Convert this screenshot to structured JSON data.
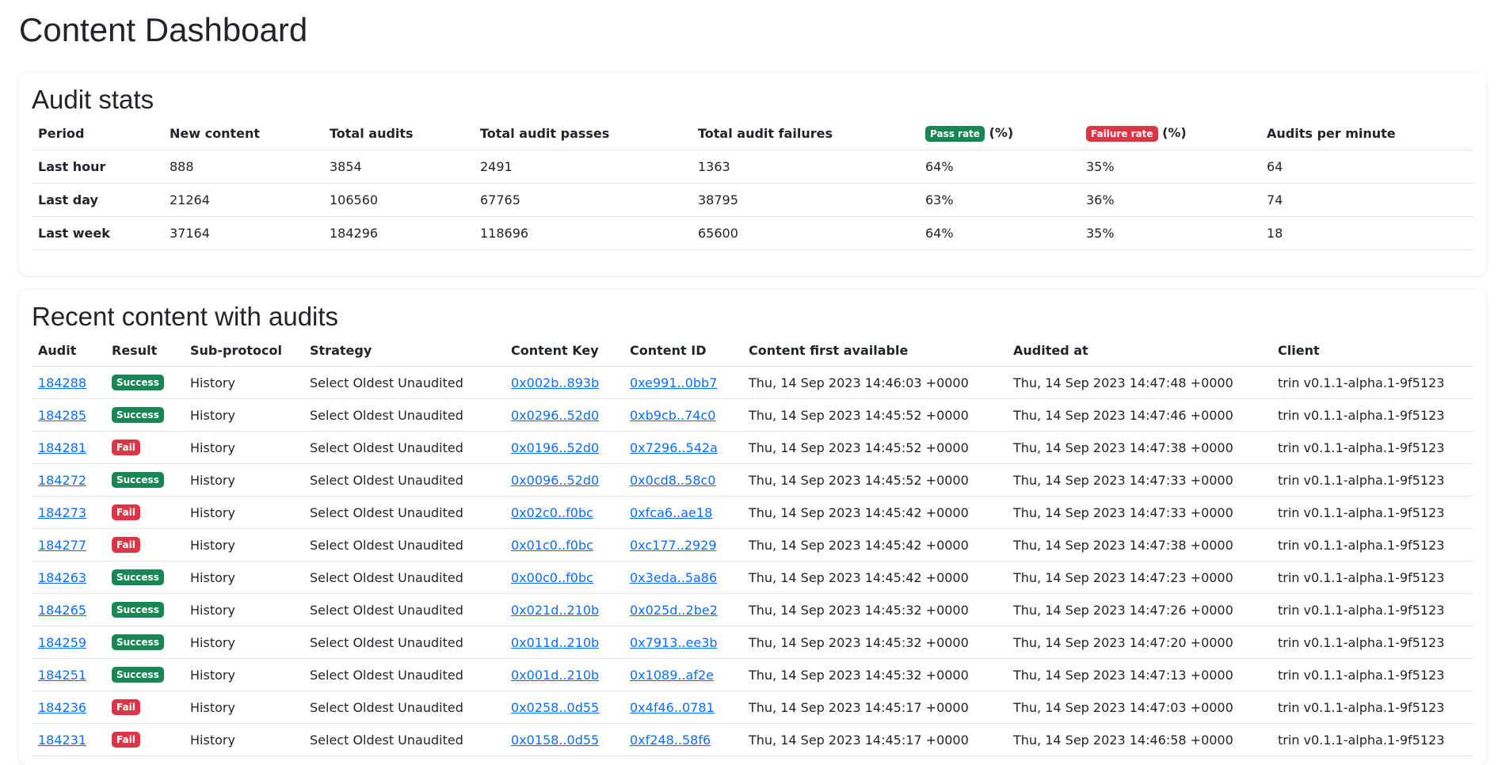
{
  "page": {
    "title": "Content Dashboard"
  },
  "colors": {
    "success": "#198754",
    "danger": "#dc3545",
    "link": "#0d6efd"
  },
  "stats": {
    "title": "Audit stats",
    "headers": {
      "period": "Period",
      "new_content": "New content",
      "total_audits": "Total audits",
      "total_passes": "Total audit passes",
      "total_failures": "Total audit failures",
      "pass_rate_badge": "Pass rate",
      "pass_rate_unit": "(%)",
      "failure_rate_badge": "Failure rate",
      "failure_rate_unit": "(%)",
      "audits_per_minute": "Audits per minute"
    },
    "rows": [
      {
        "period": "Last hour",
        "new_content": "888",
        "total_audits": "3854",
        "passes": "2491",
        "failures": "1363",
        "pass_rate": "64%",
        "failure_rate": "35%",
        "apm": "64"
      },
      {
        "period": "Last day",
        "new_content": "21264",
        "total_audits": "106560",
        "passes": "67765",
        "failures": "38795",
        "pass_rate": "63%",
        "failure_rate": "36%",
        "apm": "74"
      },
      {
        "period": "Last week",
        "new_content": "37164",
        "total_audits": "184296",
        "passes": "118696",
        "failures": "65600",
        "pass_rate": "64%",
        "failure_rate": "35%",
        "apm": "18"
      }
    ]
  },
  "recent": {
    "title": "Recent content with audits",
    "headers": {
      "audit": "Audit",
      "result": "Result",
      "subprotocol": "Sub-protocol",
      "strategy": "Strategy",
      "content_key": "Content Key",
      "content_id": "Content ID",
      "first_available": "Content first available",
      "audited_at": "Audited at",
      "client": "Client"
    },
    "rows": [
      {
        "audit": "184288",
        "result": "Success",
        "subprotocol": "History",
        "strategy": "Select Oldest Unaudited",
        "content_key": "0x002b..893b",
        "content_id": "0xe991..0bb7",
        "first_available": "Thu, 14 Sep 2023 14:46:03 +0000",
        "audited_at": "Thu, 14 Sep 2023 14:47:48 +0000",
        "client": "trin v0.1.1-alpha.1-9f5123"
      },
      {
        "audit": "184285",
        "result": "Success",
        "subprotocol": "History",
        "strategy": "Select Oldest Unaudited",
        "content_key": "0x0296..52d0",
        "content_id": "0xb9cb..74c0",
        "first_available": "Thu, 14 Sep 2023 14:45:52 +0000",
        "audited_at": "Thu, 14 Sep 2023 14:47:46 +0000",
        "client": "trin v0.1.1-alpha.1-9f5123"
      },
      {
        "audit": "184281",
        "result": "Fail",
        "subprotocol": "History",
        "strategy": "Select Oldest Unaudited",
        "content_key": "0x0196..52d0",
        "content_id": "0x7296..542a",
        "first_available": "Thu, 14 Sep 2023 14:45:52 +0000",
        "audited_at": "Thu, 14 Sep 2023 14:47:38 +0000",
        "client": "trin v0.1.1-alpha.1-9f5123"
      },
      {
        "audit": "184272",
        "result": "Success",
        "subprotocol": "History",
        "strategy": "Select Oldest Unaudited",
        "content_key": "0x0096..52d0",
        "content_id": "0x0cd8..58c0",
        "first_available": "Thu, 14 Sep 2023 14:45:52 +0000",
        "audited_at": "Thu, 14 Sep 2023 14:47:33 +0000",
        "client": "trin v0.1.1-alpha.1-9f5123"
      },
      {
        "audit": "184273",
        "result": "Fail",
        "subprotocol": "History",
        "strategy": "Select Oldest Unaudited",
        "content_key": "0x02c0..f0bc",
        "content_id": "0xfca6..ae18",
        "first_available": "Thu, 14 Sep 2023 14:45:42 +0000",
        "audited_at": "Thu, 14 Sep 2023 14:47:33 +0000",
        "client": "trin v0.1.1-alpha.1-9f5123"
      },
      {
        "audit": "184277",
        "result": "Fail",
        "subprotocol": "History",
        "strategy": "Select Oldest Unaudited",
        "content_key": "0x01c0..f0bc",
        "content_id": "0xc177..2929",
        "first_available": "Thu, 14 Sep 2023 14:45:42 +0000",
        "audited_at": "Thu, 14 Sep 2023 14:47:38 +0000",
        "client": "trin v0.1.1-alpha.1-9f5123"
      },
      {
        "audit": "184263",
        "result": "Success",
        "subprotocol": "History",
        "strategy": "Select Oldest Unaudited",
        "content_key": "0x00c0..f0bc",
        "content_id": "0x3eda..5a86",
        "first_available": "Thu, 14 Sep 2023 14:45:42 +0000",
        "audited_at": "Thu, 14 Sep 2023 14:47:23 +0000",
        "client": "trin v0.1.1-alpha.1-9f5123"
      },
      {
        "audit": "184265",
        "result": "Success",
        "subprotocol": "History",
        "strategy": "Select Oldest Unaudited",
        "content_key": "0x021d..210b",
        "content_id": "0x025d..2be2",
        "first_available": "Thu, 14 Sep 2023 14:45:32 +0000",
        "audited_at": "Thu, 14 Sep 2023 14:47:26 +0000",
        "client": "trin v0.1.1-alpha.1-9f5123"
      },
      {
        "audit": "184259",
        "result": "Success",
        "subprotocol": "History",
        "strategy": "Select Oldest Unaudited",
        "content_key": "0x011d..210b",
        "content_id": "0x7913..ee3b",
        "first_available": "Thu, 14 Sep 2023 14:45:32 +0000",
        "audited_at": "Thu, 14 Sep 2023 14:47:20 +0000",
        "client": "trin v0.1.1-alpha.1-9f5123"
      },
      {
        "audit": "184251",
        "result": "Success",
        "subprotocol": "History",
        "strategy": "Select Oldest Unaudited",
        "content_key": "0x001d..210b",
        "content_id": "0x1089..af2e",
        "first_available": "Thu, 14 Sep 2023 14:45:32 +0000",
        "audited_at": "Thu, 14 Sep 2023 14:47:13 +0000",
        "client": "trin v0.1.1-alpha.1-9f5123"
      },
      {
        "audit": "184236",
        "result": "Fail",
        "subprotocol": "History",
        "strategy": "Select Oldest Unaudited",
        "content_key": "0x0258..0d55",
        "content_id": "0x4f46..0781",
        "first_available": "Thu, 14 Sep 2023 14:45:17 +0000",
        "audited_at": "Thu, 14 Sep 2023 14:47:03 +0000",
        "client": "trin v0.1.1-alpha.1-9f5123"
      },
      {
        "audit": "184231",
        "result": "Fail",
        "subprotocol": "History",
        "strategy": "Select Oldest Unaudited",
        "content_key": "0x0158..0d55",
        "content_id": "0xf248..58f6",
        "first_available": "Thu, 14 Sep 2023 14:45:17 +0000",
        "audited_at": "Thu, 14 Sep 2023 14:46:58 +0000",
        "client": "trin v0.1.1-alpha.1-9f5123"
      }
    ]
  }
}
